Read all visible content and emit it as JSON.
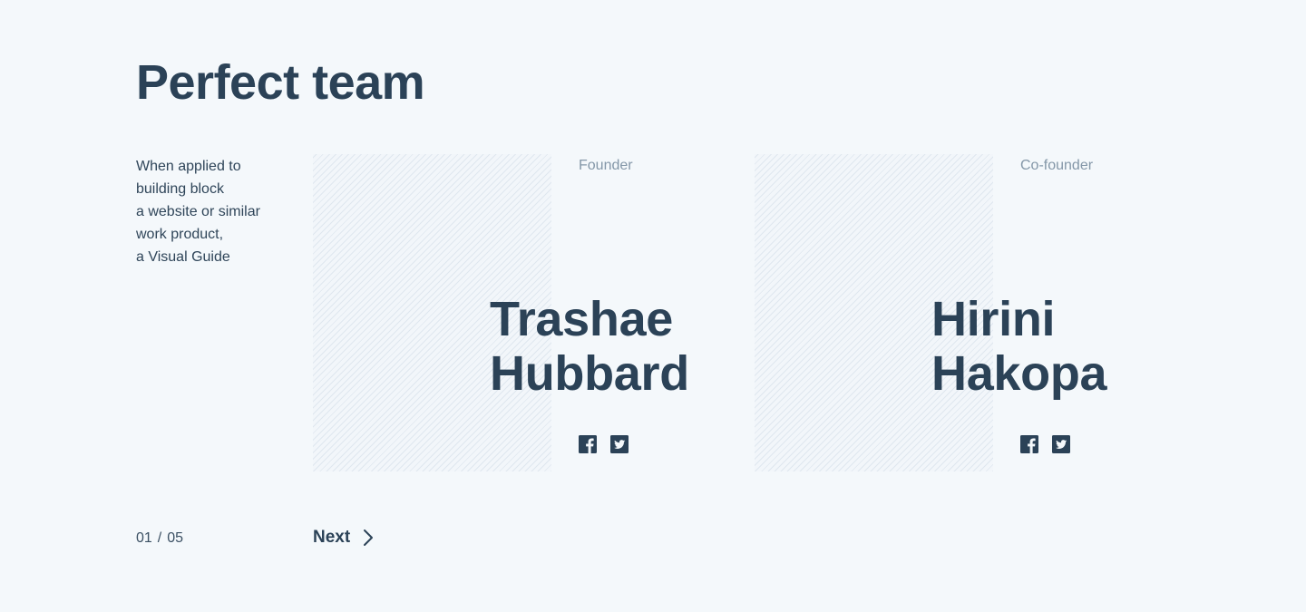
{
  "section": {
    "title": "Perfect team",
    "intro_lines": [
      "When applied to",
      "building block",
      "a website or similar",
      "work product,",
      "a Visual Guide"
    ]
  },
  "team": [
    {
      "role": "Founder",
      "first_name": "Trashae",
      "last_name": "Hubbard",
      "social": [
        "facebook-icon",
        "twitter-icon"
      ]
    },
    {
      "role": "Co-founder",
      "first_name": "Hirini",
      "last_name": "Hakopa",
      "social": [
        "facebook-icon",
        "twitter-icon"
      ]
    }
  ],
  "pagination": {
    "current": "01",
    "separator": "/",
    "total": "05",
    "next_label": "Next"
  },
  "colors": {
    "background": "#f4f8fb",
    "text_dark": "#2b4257",
    "text_muted": "#8497a8",
    "photo_stripes": "#dfe7ef"
  }
}
